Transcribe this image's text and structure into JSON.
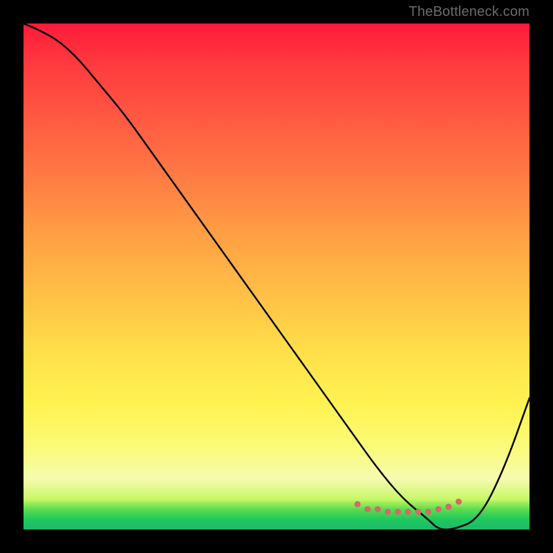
{
  "attribution": "TheBottleneck.com",
  "chart_data": {
    "type": "line",
    "title": "",
    "xlabel": "",
    "ylabel": "",
    "xlim": [
      0,
      100
    ],
    "ylim": [
      0,
      100
    ],
    "background_gradient": {
      "top": "#ff1a3a",
      "upper_mid": "#ffa044",
      "mid": "#ffe24a",
      "lower_mid": "#f6fbb0",
      "bottom": "#1fb86a"
    },
    "series": [
      {
        "name": "bottleneck-curve",
        "color": "#000000",
        "stroke_width": 2.5,
        "x": [
          0,
          5,
          10,
          15,
          20,
          25,
          30,
          35,
          40,
          45,
          50,
          55,
          60,
          65,
          70,
          75,
          80,
          82,
          85,
          90,
          95,
          100
        ],
        "y": [
          100,
          98,
          94,
          88,
          82,
          75,
          68,
          61,
          54,
          47,
          40,
          33,
          26,
          19,
          12,
          6,
          2,
          0,
          0,
          2,
          12,
          26
        ]
      }
    ],
    "marker_band": {
      "name": "optimal-range-dots",
      "color": "#d46a6a",
      "radius": 4.5,
      "x": [
        66,
        68,
        70,
        72,
        74,
        76,
        78,
        80,
        82,
        84,
        86
      ],
      "y": [
        5,
        4,
        4,
        3.5,
        3.5,
        3.5,
        3.5,
        3.5,
        4,
        4.5,
        5.5
      ]
    }
  }
}
